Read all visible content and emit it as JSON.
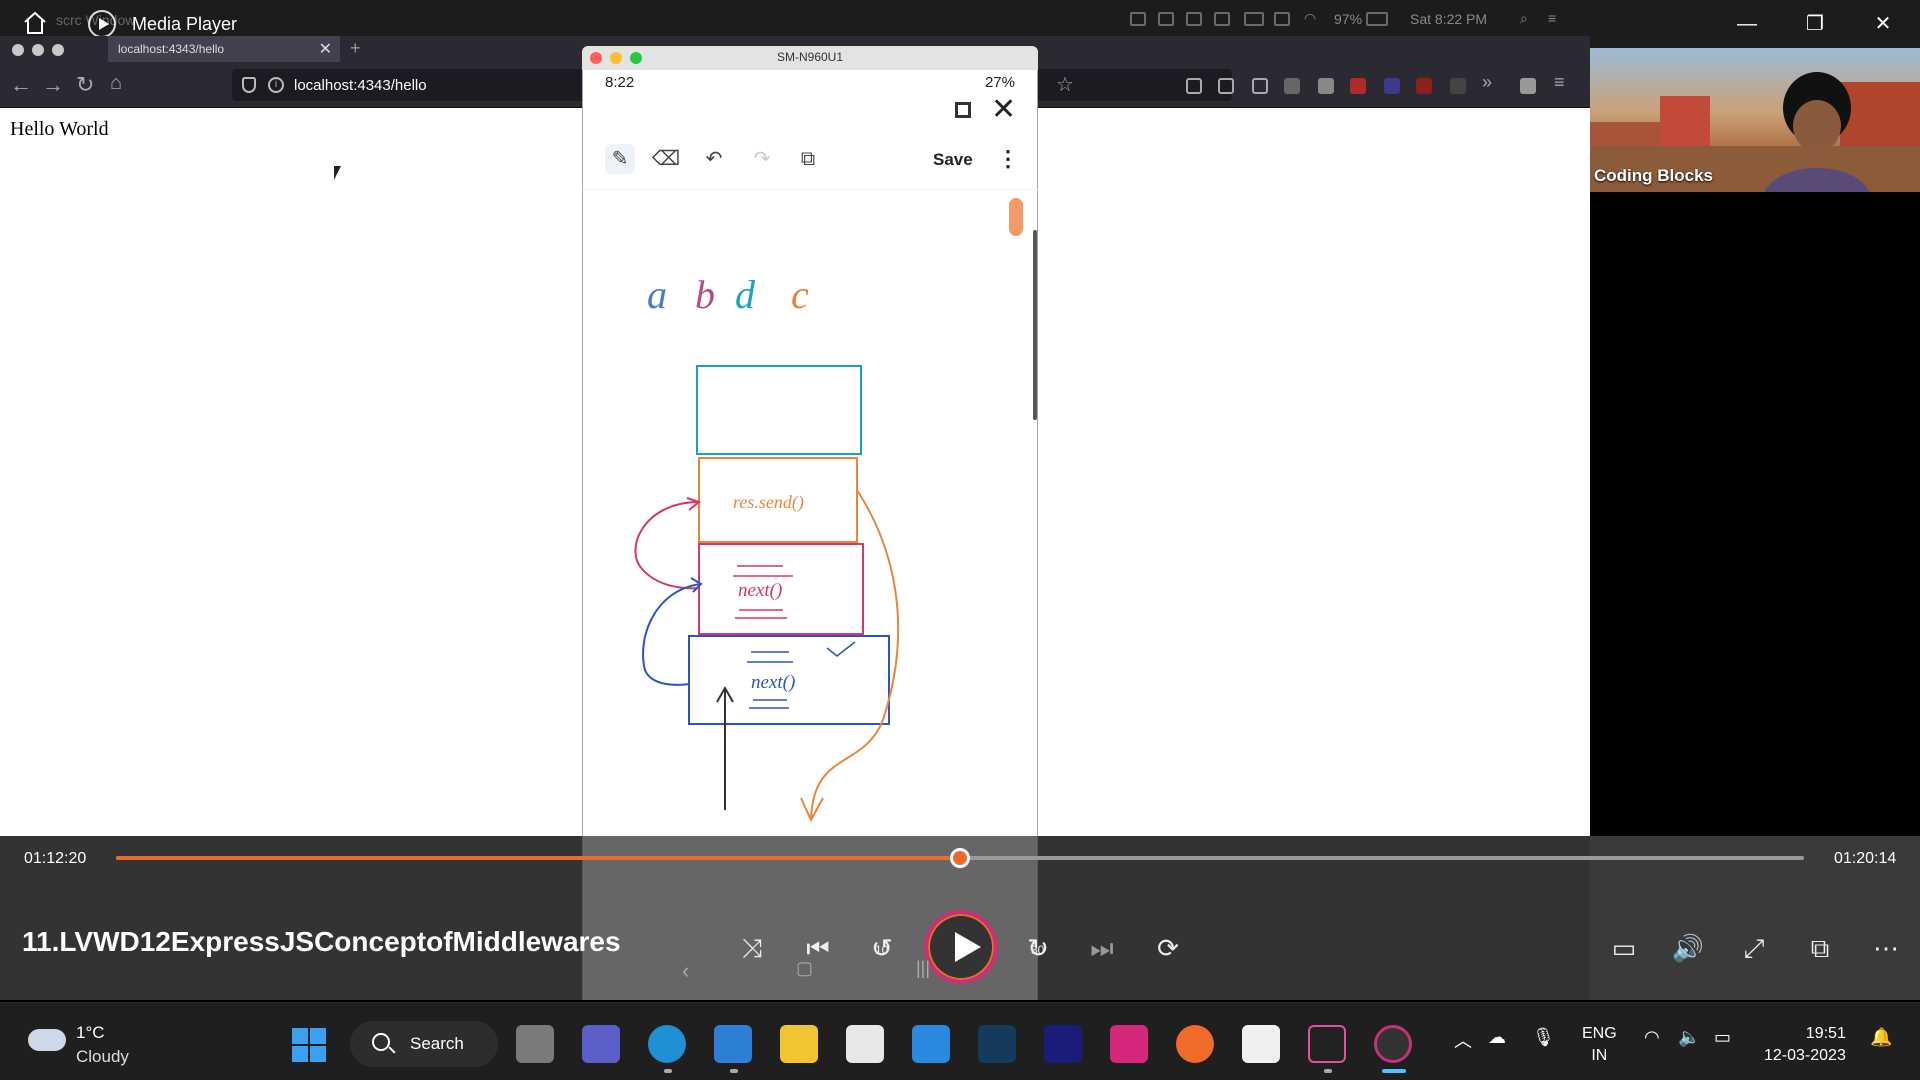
{
  "player": {
    "app_title": "Media Player",
    "media_title": "11.LVWD12ExpressJSConceptofMiddlewares",
    "current_time": "01:12:20",
    "total_time": "01:20:14",
    "progress": 0.5,
    "accent": "#ee6a2a",
    "skip_back_seconds": "10",
    "skip_forward_seconds": "30"
  },
  "mac": {
    "menu_ghost": "scrc    Window",
    "battery": "97%",
    "clock": "Sat 8:22 PM"
  },
  "browser": {
    "tab_title": "localhost:4343/hello",
    "url": "localhost:4343/hello",
    "page_heading": "Hello World"
  },
  "phone": {
    "window_title": "SM-N960U1",
    "time": "8:22",
    "battery": "27%",
    "save_label": "Save",
    "drawing": {
      "letters": [
        "a",
        "b",
        "d",
        "c"
      ],
      "labels": [
        "res.send()",
        "next()",
        "next()"
      ]
    }
  },
  "webcam": {
    "name": "Coding Blocks"
  },
  "taskbar": {
    "temperature": "1°C",
    "weather": "Cloudy",
    "search_label": "Search",
    "lang_top": "ENG",
    "lang_bottom": "IN",
    "time": "19:51",
    "date": "12-03-2023"
  },
  "icons": [
    "home-icon",
    "media-player-logo-icon",
    "minimize-icon",
    "restore-icon",
    "close-icon",
    "back-icon",
    "forward-icon",
    "reload-icon",
    "pen-icon",
    "eraser-icon",
    "undo-icon",
    "redo-icon",
    "shuffle-icon",
    "previous-icon",
    "play-icon",
    "next-icon",
    "repeat-icon",
    "captions-icon",
    "volume-icon",
    "fullscreen-icon",
    "miniplayer-icon",
    "more-icon",
    "windows-start-icon",
    "wifi-icon",
    "battery-icon"
  ]
}
